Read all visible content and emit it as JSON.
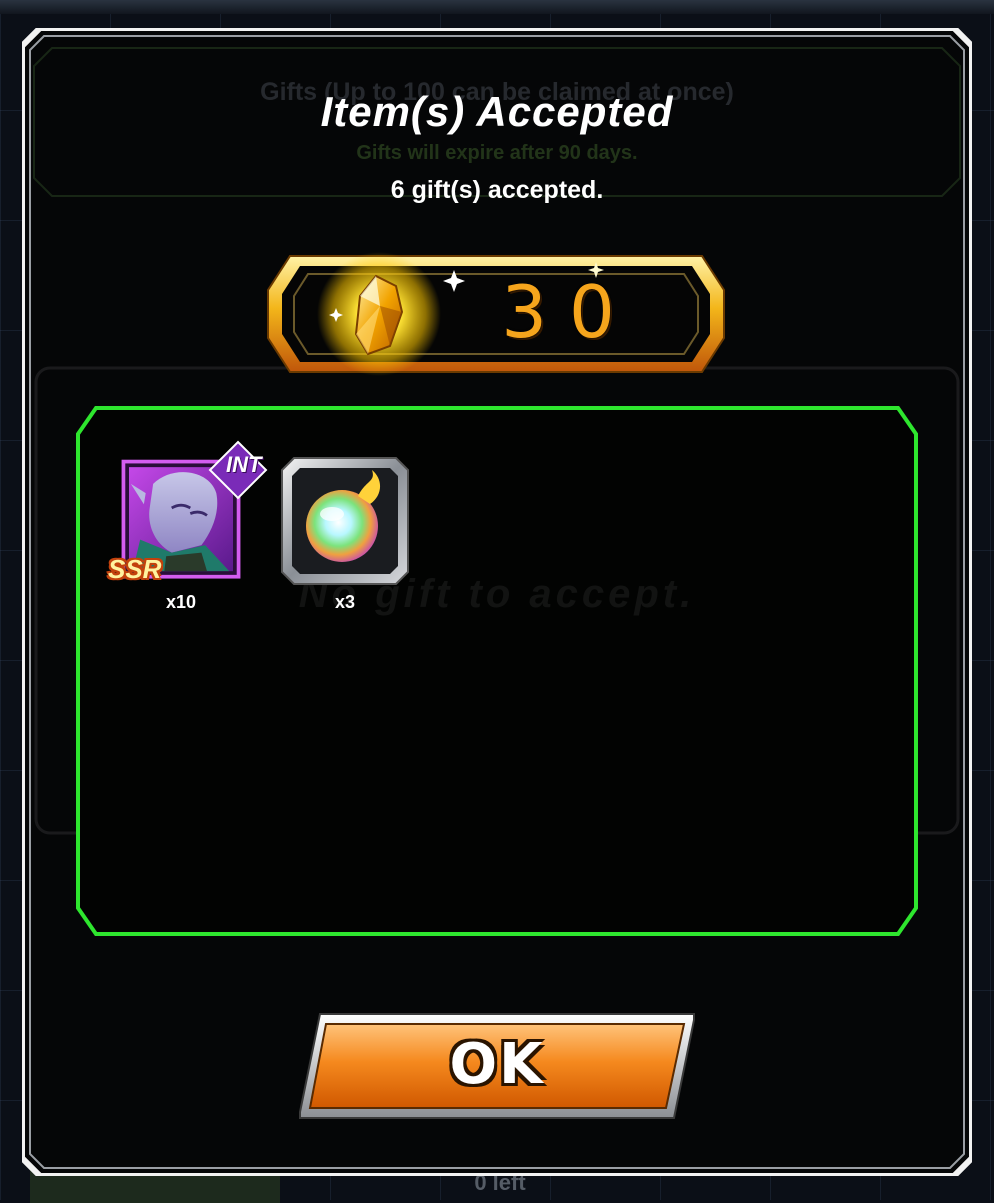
{
  "background": {
    "header_text": "Gifts (Up to 100 can be claimed at once)",
    "expire_note": "Gifts will expire after 90 days.",
    "empty_message": "No gift to accept.",
    "remaining_text": "0 left"
  },
  "dialog": {
    "title": "Item(s) Accepted",
    "subtitle": "6 gift(s) accepted.",
    "reward": {
      "icon": "dragon-stone-icon",
      "amount": "30"
    },
    "gifts": [
      {
        "icon": "ssr-int-character-card-icon",
        "rarity_badge": "SSR",
        "type_badge": "INT",
        "quantity": "x10"
      },
      {
        "icon": "rainbow-orb-icon",
        "quantity": "x3"
      }
    ],
    "ok_button": {
      "label": "OK"
    }
  },
  "colors": {
    "panel_border": "#2ee62e",
    "reward_amount": "#f6a51c",
    "button_orange": "#f07c12",
    "frame_white": "#f2f2f2"
  }
}
